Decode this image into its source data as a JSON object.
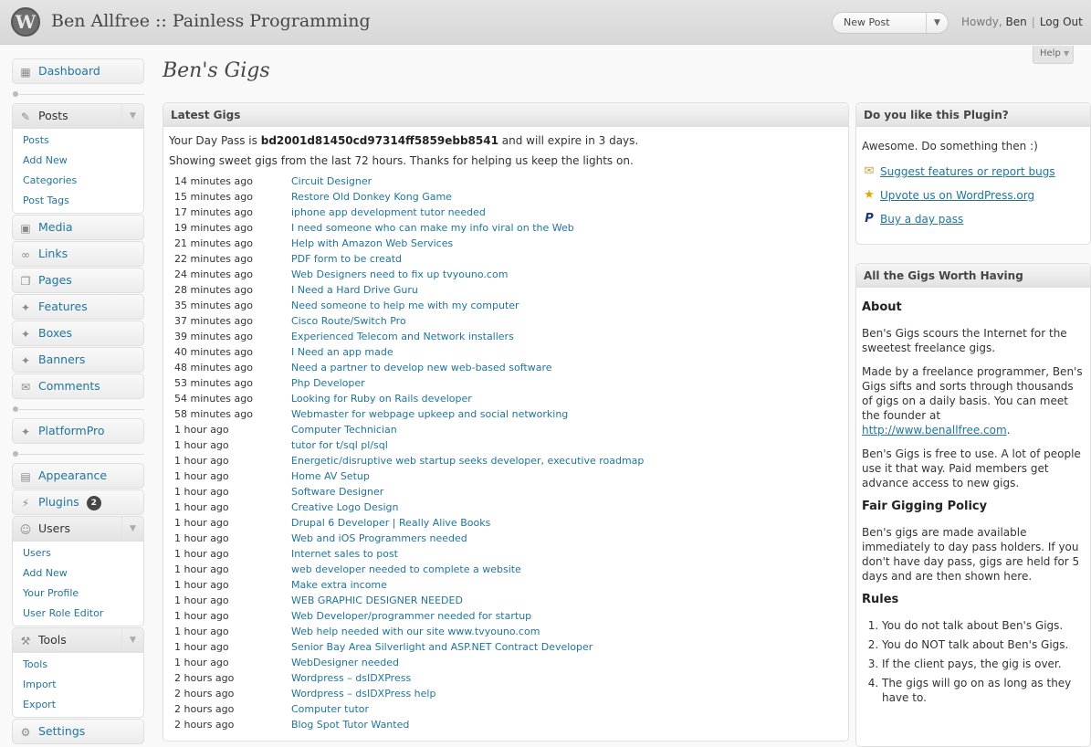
{
  "header": {
    "logo_glyph": "W",
    "site_title": "Ben Allfree :: Painless Programming",
    "new_post": "New Post",
    "howdy": "Howdy,",
    "user": "Ben",
    "logout": "Log Out"
  },
  "help_tab": "Help",
  "menu": {
    "dashboard": "Dashboard",
    "posts": "Posts",
    "posts_sub": [
      "Posts",
      "Add New",
      "Categories",
      "Post Tags"
    ],
    "media": "Media",
    "links": "Links",
    "pages": "Pages",
    "features": "Features",
    "boxes": "Boxes",
    "banners": "Banners",
    "comments": "Comments",
    "platformpro": "PlatformPro",
    "appearance": "Appearance",
    "plugins": "Plugins",
    "plugins_count": "2",
    "users": "Users",
    "users_sub": [
      "Users",
      "Add New",
      "Your Profile",
      "User Role Editor"
    ],
    "tools": "Tools",
    "tools_sub": [
      "Tools",
      "Import",
      "Export"
    ],
    "settings": "Settings"
  },
  "page_title": "Ben's Gigs",
  "latest": {
    "title": "Latest Gigs",
    "pass_prefix": "Your Day Pass is",
    "pass_code": "bd2001d81450cd97314ff5859ebb8541",
    "pass_suffix": "and will expire in 3 days.",
    "showing": "Showing sweet gigs from the last 72 hours. Thanks for helping us keep the lights on.",
    "gigs": [
      {
        "ago": "14 minutes ago",
        "title": "Circuit Designer"
      },
      {
        "ago": "15 minutes ago",
        "title": "Restore Old Donkey Kong Game"
      },
      {
        "ago": "17 minutes ago",
        "title": "iphone app development tutor needed"
      },
      {
        "ago": "19 minutes ago",
        "title": "I need someone who can make my info viral on the Web"
      },
      {
        "ago": "21 minutes ago",
        "title": "Help with Amazon Web Services"
      },
      {
        "ago": "22 minutes ago",
        "title": "PDF form to be creatd"
      },
      {
        "ago": "24 minutes ago",
        "title": "Web Designers need to fix up tvyouno.com"
      },
      {
        "ago": "28 minutes ago",
        "title": "I Need a Hard Drive Guru"
      },
      {
        "ago": "35 minutes ago",
        "title": "Need someone to help me with my computer"
      },
      {
        "ago": "37 minutes ago",
        "title": "Cisco Route/Switch Pro"
      },
      {
        "ago": "39 minutes ago",
        "title": "Experienced Telecom and Network installers"
      },
      {
        "ago": "40 minutes ago",
        "title": "I Need an app made"
      },
      {
        "ago": "48 minutes ago",
        "title": "Need a partner to develop new web-based software"
      },
      {
        "ago": "53 minutes ago",
        "title": "Php Developer"
      },
      {
        "ago": "54 minutes ago",
        "title": "Looking for Ruby on Rails developer"
      },
      {
        "ago": "58 minutes ago",
        "title": "Webmaster for webpage upkeep and social networking"
      },
      {
        "ago": "1 hour ago",
        "title": "Computer Technician"
      },
      {
        "ago": "1 hour ago",
        "title": "tutor for t/sql pl/sql"
      },
      {
        "ago": "1 hour ago",
        "title": "Energetic/disruptive web startup seeks developer, executive roadmap"
      },
      {
        "ago": "1 hour ago",
        "title": "Home AV Setup"
      },
      {
        "ago": "1 hour ago",
        "title": "Software Designer"
      },
      {
        "ago": "1 hour ago",
        "title": "Creative Logo Design"
      },
      {
        "ago": "1 hour ago",
        "title": "Drupal 6 Developer | Really Alive Books"
      },
      {
        "ago": "1 hour ago",
        "title": "Web and iOS Programmers needed"
      },
      {
        "ago": "1 hour ago",
        "title": "Internet sales to post"
      },
      {
        "ago": "1 hour ago",
        "title": "web developer needed to complete a website"
      },
      {
        "ago": "1 hour ago",
        "title": "Make extra income"
      },
      {
        "ago": "1 hour ago",
        "title": "WEB GRAPHIC DESIGNER NEEDED"
      },
      {
        "ago": "1 hour ago",
        "title": "Web Developer/programmer needed for startup"
      },
      {
        "ago": "1 hour ago",
        "title": "Web help needed with our site www.tvyouno.com"
      },
      {
        "ago": "1 hour ago",
        "title": "Senior Bay Area Silverlight and ASP.NET Contract Developer"
      },
      {
        "ago": "1 hour ago",
        "title": "WebDesigner needed"
      },
      {
        "ago": "2 hours ago",
        "title": "Wordpress – dsIDXPress"
      },
      {
        "ago": "2 hours ago",
        "title": "Wordpress – dsIDXPress help"
      },
      {
        "ago": "2 hours ago",
        "title": "Computer tutor"
      },
      {
        "ago": "2 hours ago",
        "title": "Blog Spot Tutor Wanted"
      }
    ]
  },
  "like": {
    "title": "Do you like this Plugin?",
    "lead": "Awesome. Do something then :)",
    "links": [
      {
        "icon": "mail-icon",
        "text": "Suggest features or report bugs"
      },
      {
        "icon": "star-icon",
        "text": "Upvote us on WordPress.org"
      },
      {
        "icon": "paypal-icon",
        "text": "Buy a day pass"
      }
    ]
  },
  "about": {
    "title": "All the Gigs Worth Having",
    "h_about": "About",
    "p1": "Ben's Gigs scours the Internet for the sweetest freelance gigs.",
    "p2": "Made by a freelance programmer, Ben's Gigs sifts and sorts through thousands of gigs on a daily basis. You can meet the founder at",
    "p2_link": "http://www.benallfree.com",
    "p2_end": ".",
    "p3": "Ben's Gigs is free to use. A lot of people use it that way. Paid members get advance access to new gigs.",
    "h_policy": "Fair Gigging Policy",
    "p4": "Ben's gigs are made available immediately to day pass holders. If you don't have day pass, gigs are held for 5 days and are then shown here.",
    "h_rules": "Rules",
    "rules": [
      "You do not talk about Ben's Gigs.",
      "You do NOT talk about Ben's Gigs.",
      "If the client pays, the gig is over.",
      "The gigs will go on as long as they have to."
    ]
  }
}
